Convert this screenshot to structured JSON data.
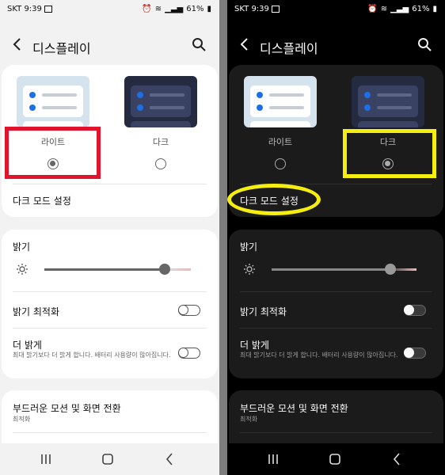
{
  "status": {
    "carrier": "SKT",
    "time": "9:39",
    "battery": "61%"
  },
  "header": {
    "title": "디스플레이"
  },
  "themes": {
    "light_label": "라이트",
    "dark_label": "다크"
  },
  "settings": {
    "dark_mode_settings": "다크 모드 설정",
    "brightness": "밝기",
    "brightness_level": 0.82,
    "adaptive_brightness": "밝기 최적화",
    "extra_brightness": "더 밝게",
    "extra_brightness_desc": "최대 밝기보다 더 밝게 합니다. 배터리 사용량이 많아집니다.",
    "motion": "부드러운 모션 및 화면 전환",
    "motion_value": "최적화"
  },
  "left_panel": {
    "mode": "light",
    "selected_theme": "라이트"
  },
  "right_panel": {
    "mode": "dark",
    "selected_theme": "다크"
  },
  "colors": {
    "accent": "#1e6fe6",
    "highlight_red": "#e0142c",
    "highlight_yellow": "#f5ee10"
  }
}
